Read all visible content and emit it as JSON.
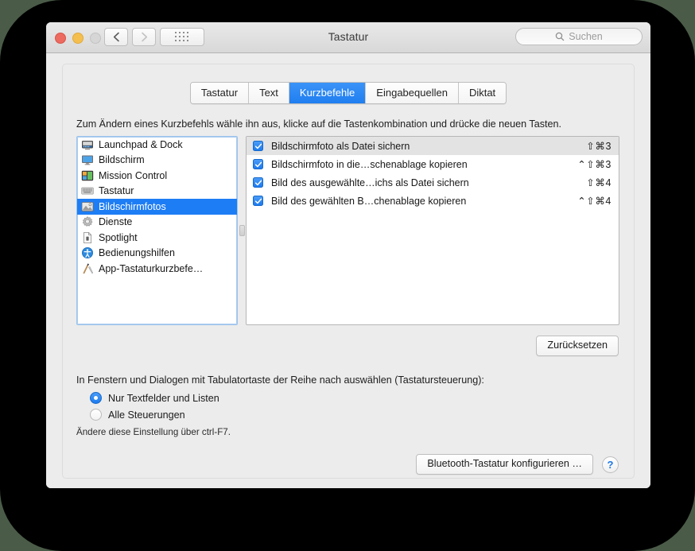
{
  "window": {
    "title": "Tastatur",
    "traffic": {
      "close": "close-button",
      "minimize": "minimize-button",
      "zoom": "zoom-button"
    },
    "nav": {
      "back": "back-button",
      "forward": "forward-button",
      "grid": "show-all-button"
    },
    "search": {
      "placeholder": "Suchen",
      "value": ""
    }
  },
  "tabs": [
    {
      "label": "Tastatur",
      "active": false
    },
    {
      "label": "Text",
      "active": false
    },
    {
      "label": "Kurzbefehle",
      "active": true
    },
    {
      "label": "Eingabequellen",
      "active": false
    },
    {
      "label": "Diktat",
      "active": false
    }
  ],
  "hint": "Zum Ändern eines Kurzbefehls wähle ihn aus, klicke auf die Tastenkombination und drücke die neuen Tasten.",
  "categories": [
    {
      "label": "Launchpad & Dock",
      "icon": "launchpad-dock-icon",
      "selected": false
    },
    {
      "label": "Bildschirm",
      "icon": "display-icon",
      "selected": false
    },
    {
      "label": "Mission Control",
      "icon": "mission-control-icon",
      "selected": false
    },
    {
      "label": "Tastatur",
      "icon": "keyboard-icon",
      "selected": false
    },
    {
      "label": "Bildschirmfotos",
      "icon": "screenshots-icon",
      "selected": true
    },
    {
      "label": "Dienste",
      "icon": "services-gear-icon",
      "selected": false
    },
    {
      "label": "Spotlight",
      "icon": "spotlight-icon",
      "selected": false
    },
    {
      "label": "Bedienungshilfen",
      "icon": "accessibility-icon",
      "selected": false
    },
    {
      "label": "App-Tastaturkurzbefe…",
      "icon": "app-shortcuts-icon",
      "selected": false
    }
  ],
  "shortcuts": [
    {
      "name": "Bildschirmfoto als Datei sichern",
      "keys": "⇧⌘3",
      "checked": true,
      "highlighted": true
    },
    {
      "name": "Bildschirmfoto in die…schenablage kopieren",
      "keys": "⌃⇧⌘3",
      "checked": true,
      "highlighted": false
    },
    {
      "name": "Bild des ausgewählte…ichs als Datei sichern",
      "keys": "⇧⌘4",
      "checked": true,
      "highlighted": false
    },
    {
      "name": "Bild des gewählten B…chenablage kopieren",
      "keys": "⌃⇧⌘4",
      "checked": true,
      "highlighted": false
    }
  ],
  "reset_button": "Zurücksetzen",
  "tab_order": {
    "title": "In Fenstern und Dialogen mit Tabulatortaste der Reihe nach auswählen (Tastatursteuerung):",
    "options": [
      {
        "label": "Nur Textfelder und Listen",
        "selected": true
      },
      {
        "label": "Alle Steuerungen",
        "selected": false
      }
    ],
    "footnote": "Ändere diese Einstellung über ctrl-F7."
  },
  "bottom": {
    "bluetooth_button": "Bluetooth-Tastatur konfigurieren …",
    "help_button": "?"
  },
  "colors": {
    "accent": "#1d7df5",
    "window_bg": "#ececec",
    "page_bg": "#4a5c48",
    "backdrop": "#000000"
  }
}
